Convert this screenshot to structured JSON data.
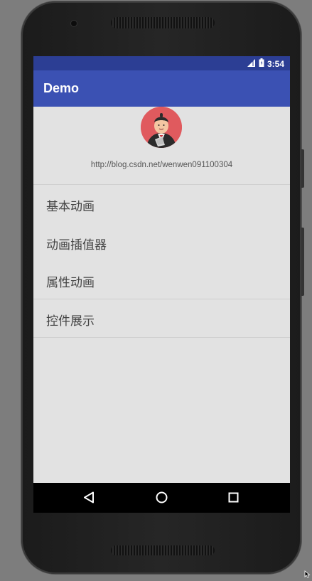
{
  "status_bar": {
    "time": "3:54"
  },
  "app_bar": {
    "title": "Demo"
  },
  "header": {
    "url": "http://blog.csdn.net/wenwen091100304"
  },
  "menu": {
    "items": [
      {
        "label": "基本动画"
      },
      {
        "label": "动画插值器"
      },
      {
        "label": "属性动画"
      },
      {
        "label": "控件展示"
      }
    ]
  },
  "nav_bar": {
    "buttons": [
      "back-icon",
      "home-icon",
      "recents-icon"
    ]
  },
  "colors": {
    "status_bar": "#2c3e94",
    "app_bar": "#3b51b3",
    "background": "#e2e2e2",
    "avatar_bg": "#e05a5e"
  }
}
